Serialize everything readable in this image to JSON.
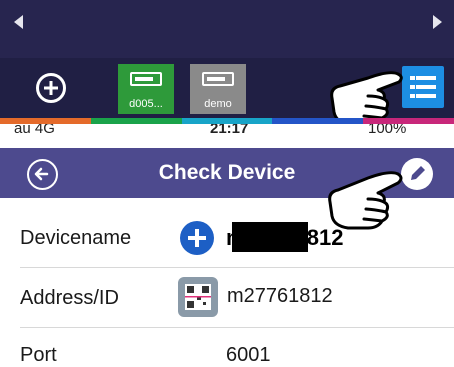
{
  "top_bar": {
    "devices": [
      {
        "label": "d005...",
        "color": "#2e9a3a"
      },
      {
        "label": "demo",
        "color": "#8a8a8a"
      }
    ],
    "strip_colors": [
      "#e46a2a",
      "#1aa34a",
      "#18a4c8",
      "#2455c8",
      "#c8277a"
    ]
  },
  "status_bar": {
    "carrier": "au 4G",
    "time": "21:17",
    "battery": "100%"
  },
  "nav": {
    "title": "Check Device"
  },
  "form": {
    "device_name": {
      "label": "Devicename",
      "value": "m27761812"
    },
    "address": {
      "label": "Address/ID",
      "value": "m27761812"
    },
    "port": {
      "label": "Port",
      "value": "6001"
    }
  },
  "icons": {
    "back": "back-arrow-circle-icon",
    "edit": "pencil-circle-icon",
    "add": "plus-circle-icon",
    "qr": "qr-code-icon",
    "menu": "list-menu-icon",
    "pointer": "pointing-hand-icon"
  },
  "colors": {
    "nav_bg": "#4d4a8e",
    "device_bar_bg": "#201f44",
    "menu_button": "#1d8ee3",
    "add_icon": "#1d5fc5"
  }
}
